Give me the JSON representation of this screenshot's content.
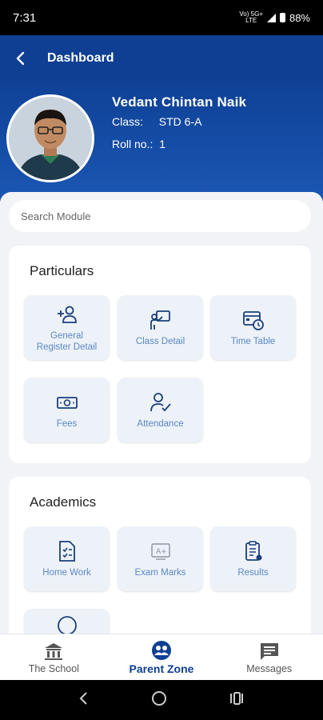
{
  "status_bar": {
    "time": "7:31",
    "network_top": "Vo) 5G+",
    "network_bottom": "LTE",
    "battery": "88%"
  },
  "app_bar": {
    "title": "Dashboard"
  },
  "profile": {
    "name": "Vedant Chintan Naik",
    "class_label": "Class:",
    "class_value": "STD 6-A",
    "roll_label": "Roll no.:",
    "roll_value": "1"
  },
  "search": {
    "placeholder": "Search Module",
    "value": ""
  },
  "sections": [
    {
      "title": "Particulars",
      "items": [
        {
          "label": "General Register Detail",
          "icon": "add-person-icon"
        },
        {
          "label": "Class Detail",
          "icon": "presentation-icon"
        },
        {
          "label": "Time Table",
          "icon": "calendar-clock-icon"
        },
        {
          "label": "Fees",
          "icon": "banknote-icon"
        },
        {
          "label": "Attendance",
          "icon": "person-check-icon"
        }
      ]
    },
    {
      "title": "Academics",
      "items": [
        {
          "label": "Home Work",
          "icon": "checklist-icon"
        },
        {
          "label": "Exam Marks",
          "icon": "grade-icon"
        },
        {
          "label": "Results",
          "icon": "clipboard-icon"
        },
        {
          "label": "",
          "icon": "circle-icon"
        }
      ]
    }
  ],
  "bottom_nav": [
    {
      "label": "The School",
      "icon": "school-icon",
      "active": false
    },
    {
      "label": "Parent Zone",
      "icon": "parent-zone-icon",
      "active": true
    },
    {
      "label": "Messages",
      "icon": "message-icon",
      "active": false
    }
  ],
  "colors": {
    "primary": "#0e3f93",
    "tile_text": "#5a87c5",
    "tile_bg": "#edf2f8",
    "background": "#f1f3f6"
  }
}
